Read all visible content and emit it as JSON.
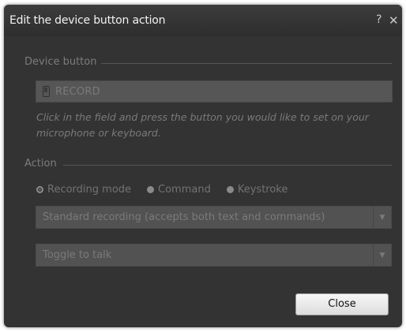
{
  "dialog": {
    "title": "Edit the device button action",
    "help_label": "?",
    "close_label": "✕"
  },
  "device_section": {
    "label": "Device button",
    "field_value": "RECORD",
    "field_icon": "device-icon",
    "hint": "Click in the field and press the button you would like to set on your microphone or keyboard."
  },
  "action_section": {
    "label": "Action",
    "radios": [
      {
        "label": "Recording mode",
        "selected": true
      },
      {
        "label": "Command",
        "selected": false
      },
      {
        "label": "Keystroke",
        "selected": false
      }
    ],
    "mode_dropdown": {
      "value": "Standard recording (accepts both text and commands)"
    },
    "toggle_dropdown": {
      "value": "Toggle to talk"
    }
  },
  "footer": {
    "close_button": "Close"
  },
  "colors": {
    "dialog_bg": "#333333",
    "title_text": "#f2f2f2",
    "disabled_text": "#7a7a7a"
  }
}
